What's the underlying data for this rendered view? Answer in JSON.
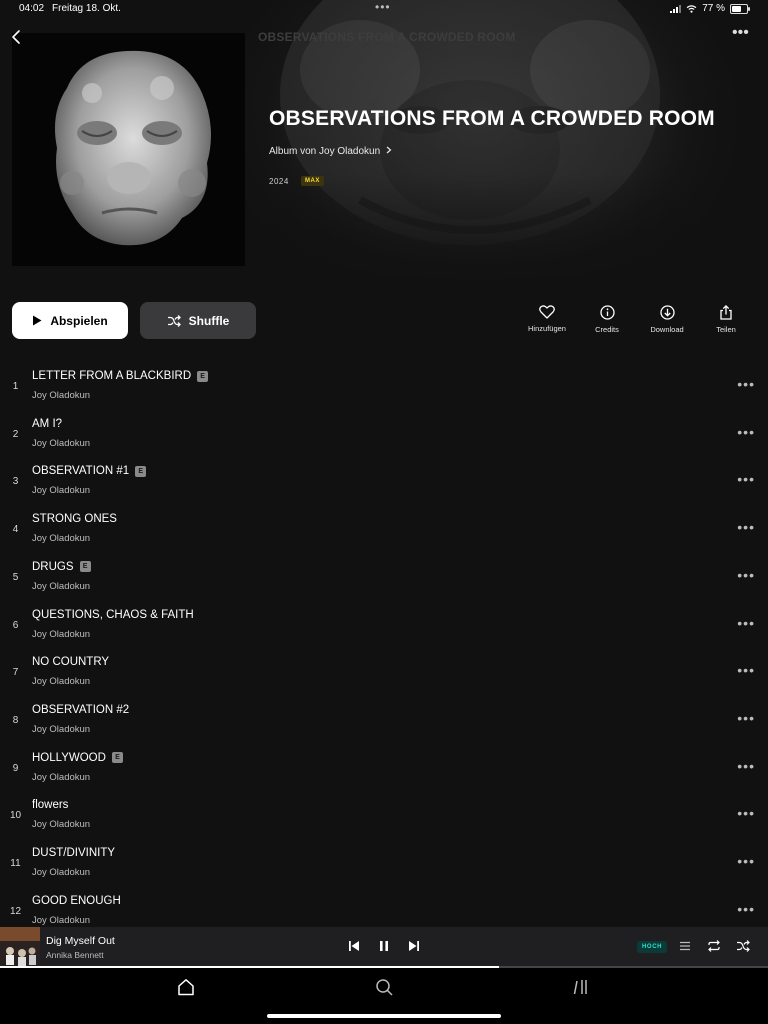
{
  "status_bar": {
    "time": "04:02",
    "date": "Freitag 18. Okt.",
    "multitask_dots": "•••",
    "battery_percent": "77 %",
    "battery_level": 0.77
  },
  "header": {
    "faded_title": "OBSERVATIONS FROM A CROWDED ROOM",
    "more_label": "•••"
  },
  "album": {
    "title": "OBSERVATIONS FROM A CROWDED ROOM",
    "artist_line": "Album von Joy Oladokun",
    "year": "2024",
    "quality": "MAX"
  },
  "actions": {
    "play_label": "Abspielen",
    "shuffle_label": "Shuffle",
    "add_label": "Hinzufügen",
    "credits_label": "Credits",
    "download_label": "Download",
    "share_label": "Teilen"
  },
  "explicit_letter": "E",
  "track_more": "•••",
  "tracks": [
    {
      "number": "1",
      "title": "LETTER FROM A BLACKBIRD",
      "artist": "Joy Oladokun",
      "explicit": true
    },
    {
      "number": "2",
      "title": "AM I?",
      "artist": "Joy Oladokun",
      "explicit": false
    },
    {
      "number": "3",
      "title": "OBSERVATION #1",
      "artist": "Joy Oladokun",
      "explicit": true
    },
    {
      "number": "4",
      "title": "STRONG ONES",
      "artist": "Joy Oladokun",
      "explicit": false
    },
    {
      "number": "5",
      "title": "DRUGS",
      "artist": "Joy Oladokun",
      "explicit": true
    },
    {
      "number": "6",
      "title": "QUESTIONS, CHAOS & FAITH",
      "artist": "Joy Oladokun",
      "explicit": false
    },
    {
      "number": "7",
      "title": "NO COUNTRY",
      "artist": "Joy Oladokun",
      "explicit": false
    },
    {
      "number": "8",
      "title": "OBSERVATION #2",
      "artist": "Joy Oladokun",
      "explicit": false
    },
    {
      "number": "9",
      "title": "HOLLYWOOD",
      "artist": "Joy Oladokun",
      "explicit": true
    },
    {
      "number": "10",
      "title": "flowers",
      "artist": "Joy Oladokun",
      "explicit": false
    },
    {
      "number": "11",
      "title": "DUST/DIVINITY",
      "artist": "Joy Oladokun",
      "explicit": false
    },
    {
      "number": "12",
      "title": "GOOD ENOUGH",
      "artist": "Joy Oladokun",
      "explicit": false
    }
  ],
  "now_playing": {
    "title": "Dig Myself Out",
    "artist": "Annika Bennett",
    "quality": "HOCH",
    "progress": 0.65
  },
  "colors": {
    "background": "#111111",
    "quality_max": "#ffd83a",
    "quality_hoch": "#2ee0d1"
  },
  "icons": {
    "back": "chevron-left-icon",
    "more": "ellipsis-icon",
    "play": "play-icon",
    "shuffle": "shuffle-icon",
    "add": "heart-icon",
    "credits": "info-icon",
    "download": "download-icon",
    "share": "share-icon",
    "prev": "skip-back-icon",
    "pause": "pause-icon",
    "next": "skip-forward-icon",
    "queue": "queue-icon",
    "repeat": "repeat-icon",
    "home": "home-icon",
    "search": "search-icon",
    "library": "library-icon"
  }
}
